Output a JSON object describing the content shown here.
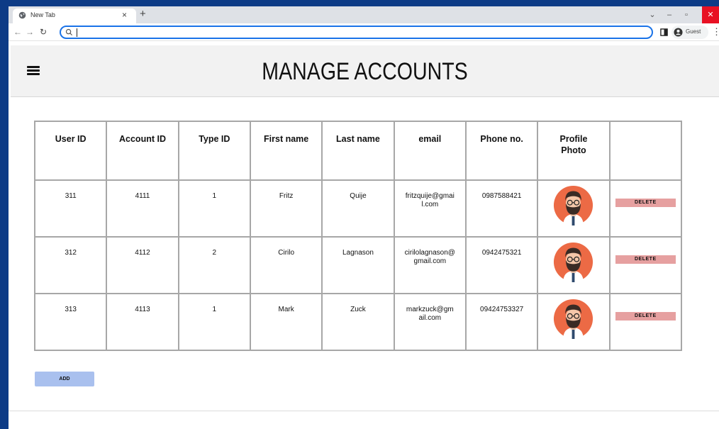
{
  "browser": {
    "tab_title": "New Tab",
    "tab_close": "×",
    "new_tab": "+",
    "profile_label": "Guest",
    "url": ""
  },
  "page": {
    "title": "MANAGE ACCOUNTS"
  },
  "table": {
    "headers": [
      "User ID",
      "Account ID",
      "Type ID",
      "First name",
      "Last name",
      "email",
      "Phone no.",
      "Profile Photo",
      ""
    ],
    "rows": [
      {
        "user_id": "311",
        "account_id": "4111",
        "type_id": "1",
        "first_name": "Fritz",
        "last_name": "Quije",
        "email": "fritzquije@gmail.com",
        "phone": "0987588421",
        "action": "DELETE"
      },
      {
        "user_id": "312",
        "account_id": "4112",
        "type_id": "2",
        "first_name": "Cirilo",
        "last_name": "Lagnason",
        "email": "cirilolagnason@gmail.com",
        "phone": "0942475321",
        "action": "DELETE"
      },
      {
        "user_id": "313",
        "account_id": "4113",
        "type_id": "1",
        "first_name": "Mark",
        "last_name": "Zuck",
        "email": "markzuck@gmail.com",
        "phone": "09424753327",
        "action": "DELETE"
      }
    ]
  },
  "buttons": {
    "add_label": "ADD"
  },
  "colors": {
    "desktop_bg": "#0d3b86",
    "delete_button": "#e6a0a0",
    "add_button": "#a9c0ee",
    "avatar_bg": "#ec6a45"
  }
}
